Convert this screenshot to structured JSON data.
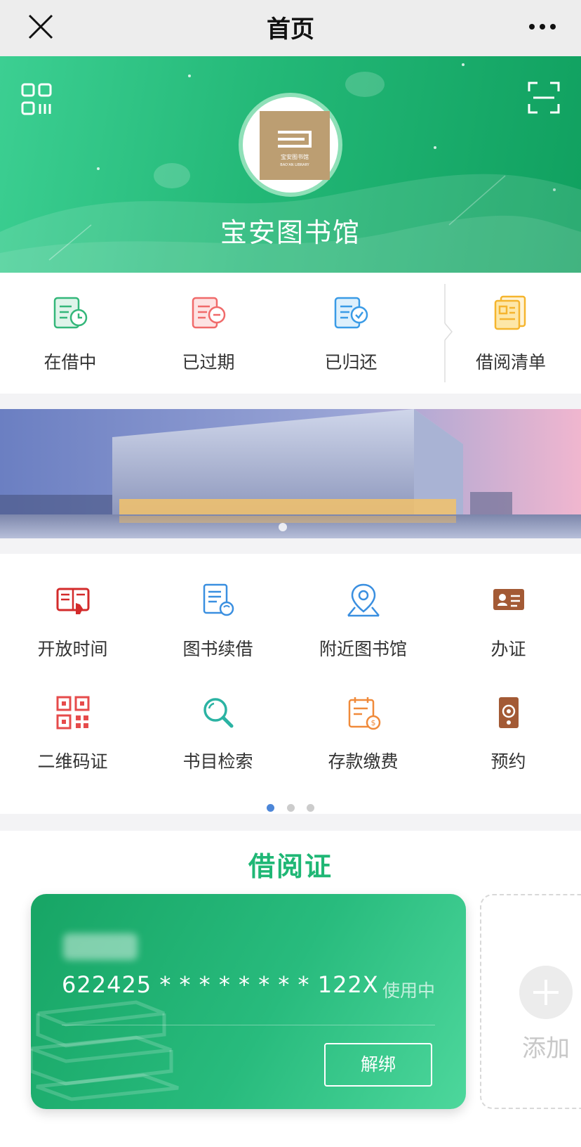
{
  "navbar": {
    "title": "首页",
    "close_icon": "close-icon",
    "more_icon": "more-icon"
  },
  "hero": {
    "library_name": "宝安图书馆",
    "logo_text": "宝安图书馆",
    "logo_subtext": "BAO'AN LIBRARY",
    "left_icon": "qr-code-icon",
    "right_icon": "scan-icon"
  },
  "borrow_status": [
    {
      "label": "在借中",
      "icon": "borrowing-icon",
      "color": "#34b77a"
    },
    {
      "label": "已过期",
      "icon": "overdue-icon",
      "color": "#f06a6a"
    },
    {
      "label": "已归还",
      "icon": "returned-icon",
      "color": "#3a9be6"
    },
    {
      "label": "借阅清单",
      "icon": "borrow-list-icon",
      "color": "#f5b52e"
    }
  ],
  "banner": {
    "slide_count": 1
  },
  "services": [
    {
      "label": "开放时间",
      "icon": "opening-hours-icon",
      "color": "#d32b2b"
    },
    {
      "label": "图书续借",
      "icon": "book-renew-icon",
      "color": "#3a8fe0"
    },
    {
      "label": "附近图书馆",
      "icon": "location-icon",
      "color": "#3a8fe0"
    },
    {
      "label": "办证",
      "icon": "id-card-icon",
      "color": "#a35a35"
    },
    {
      "label": "二维码证",
      "icon": "qr-card-icon",
      "color": "#e64b4b"
    },
    {
      "label": "书目检索",
      "icon": "search-catalog-icon",
      "color": "#2bb3a3"
    },
    {
      "label": "存款缴费",
      "icon": "payment-icon",
      "color": "#f08a3a"
    },
    {
      "label": "预约",
      "icon": "reservation-icon",
      "color": "#a35a35"
    }
  ],
  "services_pager": {
    "pages": 3,
    "active": 0
  },
  "library_card": {
    "section_title": "借阅证",
    "number": "622425 * * * * * * * * 122X",
    "status": "使用中",
    "unbind_label": "解绑",
    "add_label": "添加"
  },
  "colors": {
    "brand_green": "#1fb775",
    "accent_blue": "#4c86d8"
  }
}
